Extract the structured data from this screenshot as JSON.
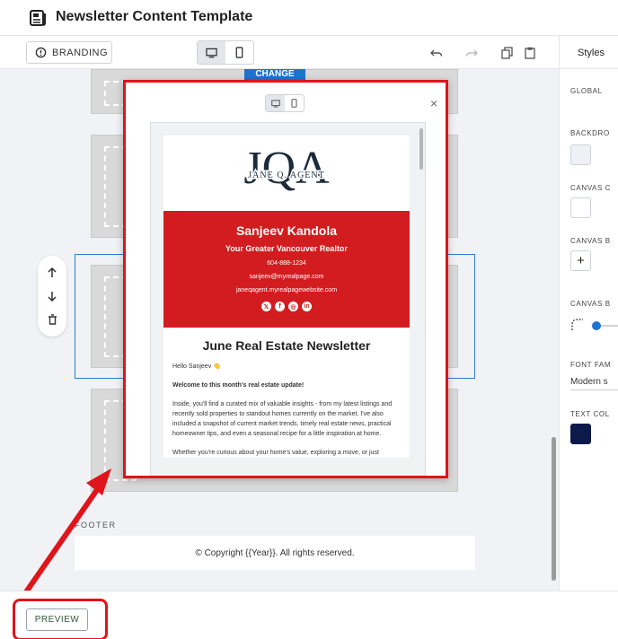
{
  "header": {
    "title": "Newsletter Content Template"
  },
  "toolbar": {
    "branding_label": "BRANDING"
  },
  "canvas": {
    "change_label": "CHANGE",
    "footer_label": "FOOTER",
    "footer_text": "© Copyright {{Year}}. All rights reserved."
  },
  "styles_panel": {
    "tab_label": "Styles",
    "global_label": "GLOBAL",
    "backdrop_label": "BACKDRO",
    "canvas_color_label": "CANVAS C",
    "canvas_border_label": "CANVAS B",
    "canvas_b2_label": "CANVAS B",
    "font_family_label": "FONT FAM",
    "font_family_value": "Modern s",
    "text_color_label": "TEXT COL",
    "colors": {
      "backdrop": "#eef1f5",
      "canvas": "#ffffff",
      "text": "#0b1a4a"
    }
  },
  "bottom": {
    "preview_label": "PREVIEW"
  },
  "email": {
    "logo_text": "JANE Q. AGENT",
    "logo_monogram": "JQA",
    "agent_name": "Sanjeev Kandola",
    "tagline": "Your Greater Vancouver Realtor",
    "phone": "604-888-1234",
    "email1": "sanjeev@myrealpage.com",
    "email2": "janeqagent.myrealpagewebsite.com",
    "headline": "June Real Estate Newsletter",
    "greeting": "Hello Sanjeev 👋",
    "welcome": "Welcome to this month's real estate update!",
    "paragraph1": "Inside, you'll find a curated mix of valuable insights - from my latest listings and recently sold properties to standout homes currently on the market. I've also included a snapshot of current market trends, timely real estate news, practical homeowner tips, and even a seasonal recipe for a little inspiration at home.",
    "paragraph2": "Whether you're curious about your home's value, exploring a move, or just"
  },
  "accent_colors": {
    "highlight": "#e0141b",
    "selection": "#2d7fd3",
    "email_red": "#d31c1f"
  }
}
